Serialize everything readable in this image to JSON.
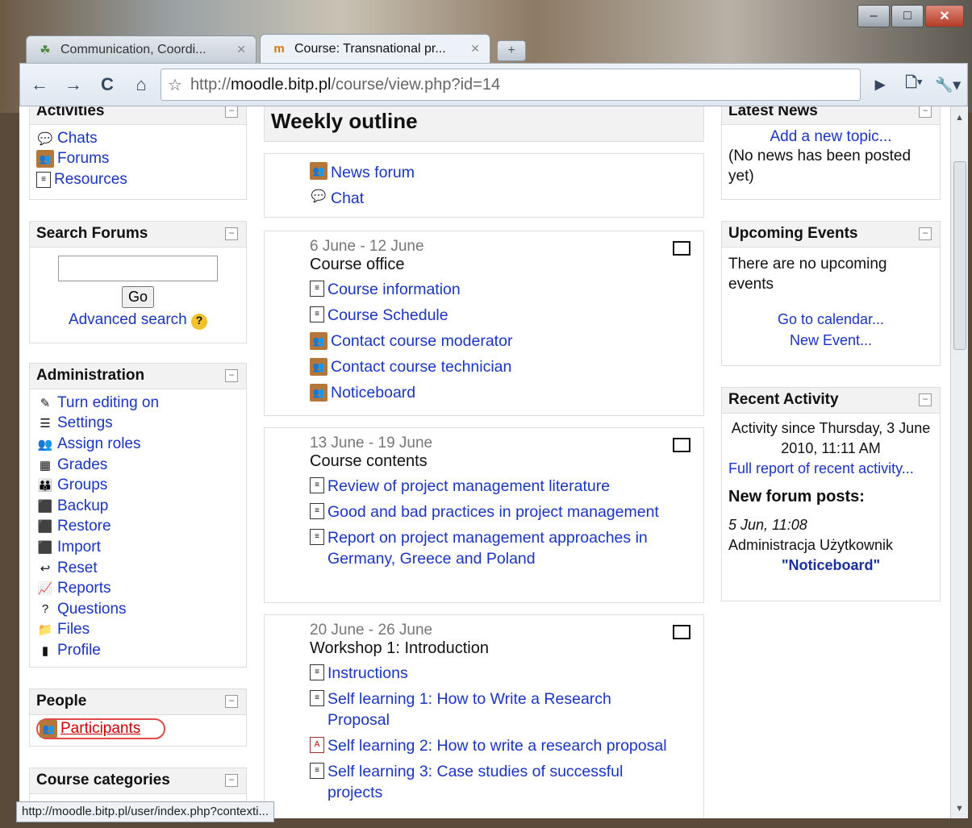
{
  "tabs": [
    {
      "title": "Communication, Coordi...",
      "active": false,
      "icon": "moodle-leaf-icon"
    },
    {
      "title": "Course: Transnational pr...",
      "active": true,
      "icon": "moodle-m-icon"
    }
  ],
  "address": {
    "prefix": "http://",
    "host": "moodle.bitp.pl",
    "path": "/course/view.php?id=14"
  },
  "left": {
    "activities": {
      "title": "Activities",
      "items": [
        {
          "label": "Chats",
          "icon": "chat-icon"
        },
        {
          "label": "Forums",
          "icon": "forum-icon"
        },
        {
          "label": "Resources",
          "icon": "resource-icon"
        }
      ]
    },
    "search": {
      "title": "Search Forums",
      "go": "Go",
      "advanced": "Advanced search"
    },
    "admin": {
      "title": "Administration",
      "items": [
        {
          "label": "Turn editing on",
          "icon": "edit-pen-icon",
          "glyph": "✎"
        },
        {
          "label": "Settings",
          "icon": "settings-icon",
          "glyph": "☰"
        },
        {
          "label": "Assign roles",
          "icon": "roles-icon",
          "glyph": "👥"
        },
        {
          "label": "Grades",
          "icon": "grades-icon",
          "glyph": "▦"
        },
        {
          "label": "Groups",
          "icon": "groups-icon",
          "glyph": "👪"
        },
        {
          "label": "Backup",
          "icon": "backup-icon",
          "glyph": "⬛"
        },
        {
          "label": "Restore",
          "icon": "restore-icon",
          "glyph": "⬛"
        },
        {
          "label": "Import",
          "icon": "import-icon",
          "glyph": "⬛"
        },
        {
          "label": "Reset",
          "icon": "reset-icon",
          "glyph": "↩"
        },
        {
          "label": "Reports",
          "icon": "reports-icon",
          "glyph": "📈"
        },
        {
          "label": "Questions",
          "icon": "questions-icon",
          "glyph": "?"
        },
        {
          "label": "Files",
          "icon": "folder-icon",
          "glyph": "📁"
        },
        {
          "label": "Profile",
          "icon": "profile-icon",
          "glyph": "▮"
        }
      ]
    },
    "people": {
      "title": "People",
      "participants": "Participants"
    },
    "categories": {
      "title": "Course categories"
    }
  },
  "main": {
    "heading": "Weekly outline",
    "top_items": [
      {
        "label": "News forum",
        "icon": "forum-icon"
      },
      {
        "label": "Chat",
        "icon": "chat-icon"
      }
    ],
    "weeks": [
      {
        "dates": "6 June - 12 June",
        "title": "Course office",
        "items": [
          {
            "label": "Course information",
            "icon": "doc-icon"
          },
          {
            "label": "Course Schedule",
            "icon": "doc-icon"
          },
          {
            "label": "Contact course moderator",
            "icon": "forum-icon"
          },
          {
            "label": "Contact course technician",
            "icon": "forum-icon"
          },
          {
            "label": "Noticeboard",
            "icon": "forum-icon"
          }
        ]
      },
      {
        "dates": "13 June - 19 June",
        "title": "Course contents",
        "items": [
          {
            "label": "Review of project management literature",
            "icon": "doc-icon"
          },
          {
            "label": "Good and bad practices in project management",
            "icon": "doc-icon"
          },
          {
            "label": "Report on project management approaches in Germany, Greece and Poland",
            "icon": "doc-icon"
          }
        ]
      },
      {
        "dates": "20 June - 26 June",
        "title": "Workshop 1: Introduction",
        "items": [
          {
            "label": "Instructions",
            "icon": "doc-icon"
          },
          {
            "label": "Self learning 1: How to Write a Research Proposal",
            "icon": "doc-icon"
          },
          {
            "label": "Self learning 2: How to write a research proposal",
            "icon": "pdf-icon"
          },
          {
            "label": "Self learning 3: Case studies of successful projects",
            "icon": "doc-icon"
          }
        ]
      }
    ]
  },
  "right": {
    "news": {
      "title": "Latest News",
      "add": "Add a new topic...",
      "empty": "(No news has been posted yet)"
    },
    "events": {
      "title": "Upcoming Events",
      "empty": "There are no upcoming events",
      "calendar": "Go to calendar...",
      "new_event": "New Event..."
    },
    "recent": {
      "title": "Recent Activity",
      "since": "Activity since Thursday, 3 June 2010, 11:11 AM",
      "full_report": "Full report of recent activity...",
      "posts_title": "New forum posts:",
      "post_date": "5 Jun, 11:08",
      "post_author": "Administracja Użytkownik",
      "post_title": "\"Noticeboard\""
    }
  },
  "status_url": "http://moodle.bitp.pl/user/index.php?contexti..."
}
